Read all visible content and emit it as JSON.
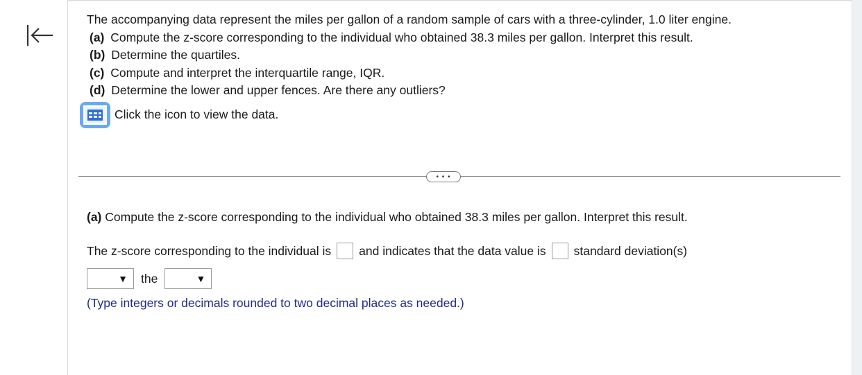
{
  "question": {
    "intro": "The accompanying data represent the miles per gallon of a random sample of cars with a three-cylinder, 1.0 liter engine.",
    "parts": [
      {
        "label": "(a)",
        "text": "Compute the z-score corresponding to the individual who obtained 38.3 miles per gallon. Interpret this result."
      },
      {
        "label": "(b)",
        "text": "Determine the quartiles."
      },
      {
        "label": "(c)",
        "text": "Compute and interpret the interquartile range, IQR."
      },
      {
        "label": "(d)",
        "text": "Determine the lower and upper fences. Are there any outliers?"
      }
    ],
    "data_link": "Click the icon to view the data."
  },
  "more_label": "• • •",
  "part_a": {
    "label": "(a)",
    "text": "Compute the z-score corresponding to the individual who obtained 38.3 miles per gallon. Interpret this result.",
    "sentence_1": "The z-score corresponding to the individual is",
    "sentence_2": "and indicates that the data value is",
    "sentence_3": "standard deviation(s)",
    "sentence_4": "the",
    "hint": "(Type integers or decimals rounded to two decimal places as needed.)"
  },
  "icons": {
    "back": "back-to-start-icon",
    "data": "data-table-icon",
    "dropdown": "dropdown-arrow-icon"
  },
  "colors": {
    "accent": "#6aa9f2",
    "hint": "#1f2a8a"
  }
}
